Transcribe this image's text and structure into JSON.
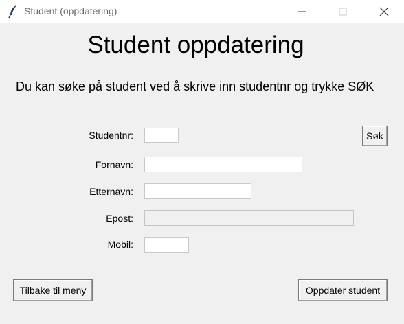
{
  "window": {
    "title": "Student (oppdatering)",
    "icon": "feather-icon",
    "controls": [
      "minimize-icon",
      "maximize-icon",
      "close-icon"
    ]
  },
  "heading": "Student oppdatering",
  "subtitle": "Du kan søke på student ved å skrive inn studentnr og trykke SØK",
  "form": {
    "studentnr": {
      "label": "Studentnr:",
      "value": ""
    },
    "fornavn": {
      "label": "Fornavn:",
      "value": ""
    },
    "etternavn": {
      "label": "Etternavn:",
      "value": ""
    },
    "epost": {
      "label": "Epost:",
      "value": "",
      "disabled": true
    },
    "mobil": {
      "label": "Mobil:",
      "value": ""
    }
  },
  "buttons": {
    "search": "Søk",
    "back": "Tilbake til meny",
    "update": "Oppdater student"
  }
}
